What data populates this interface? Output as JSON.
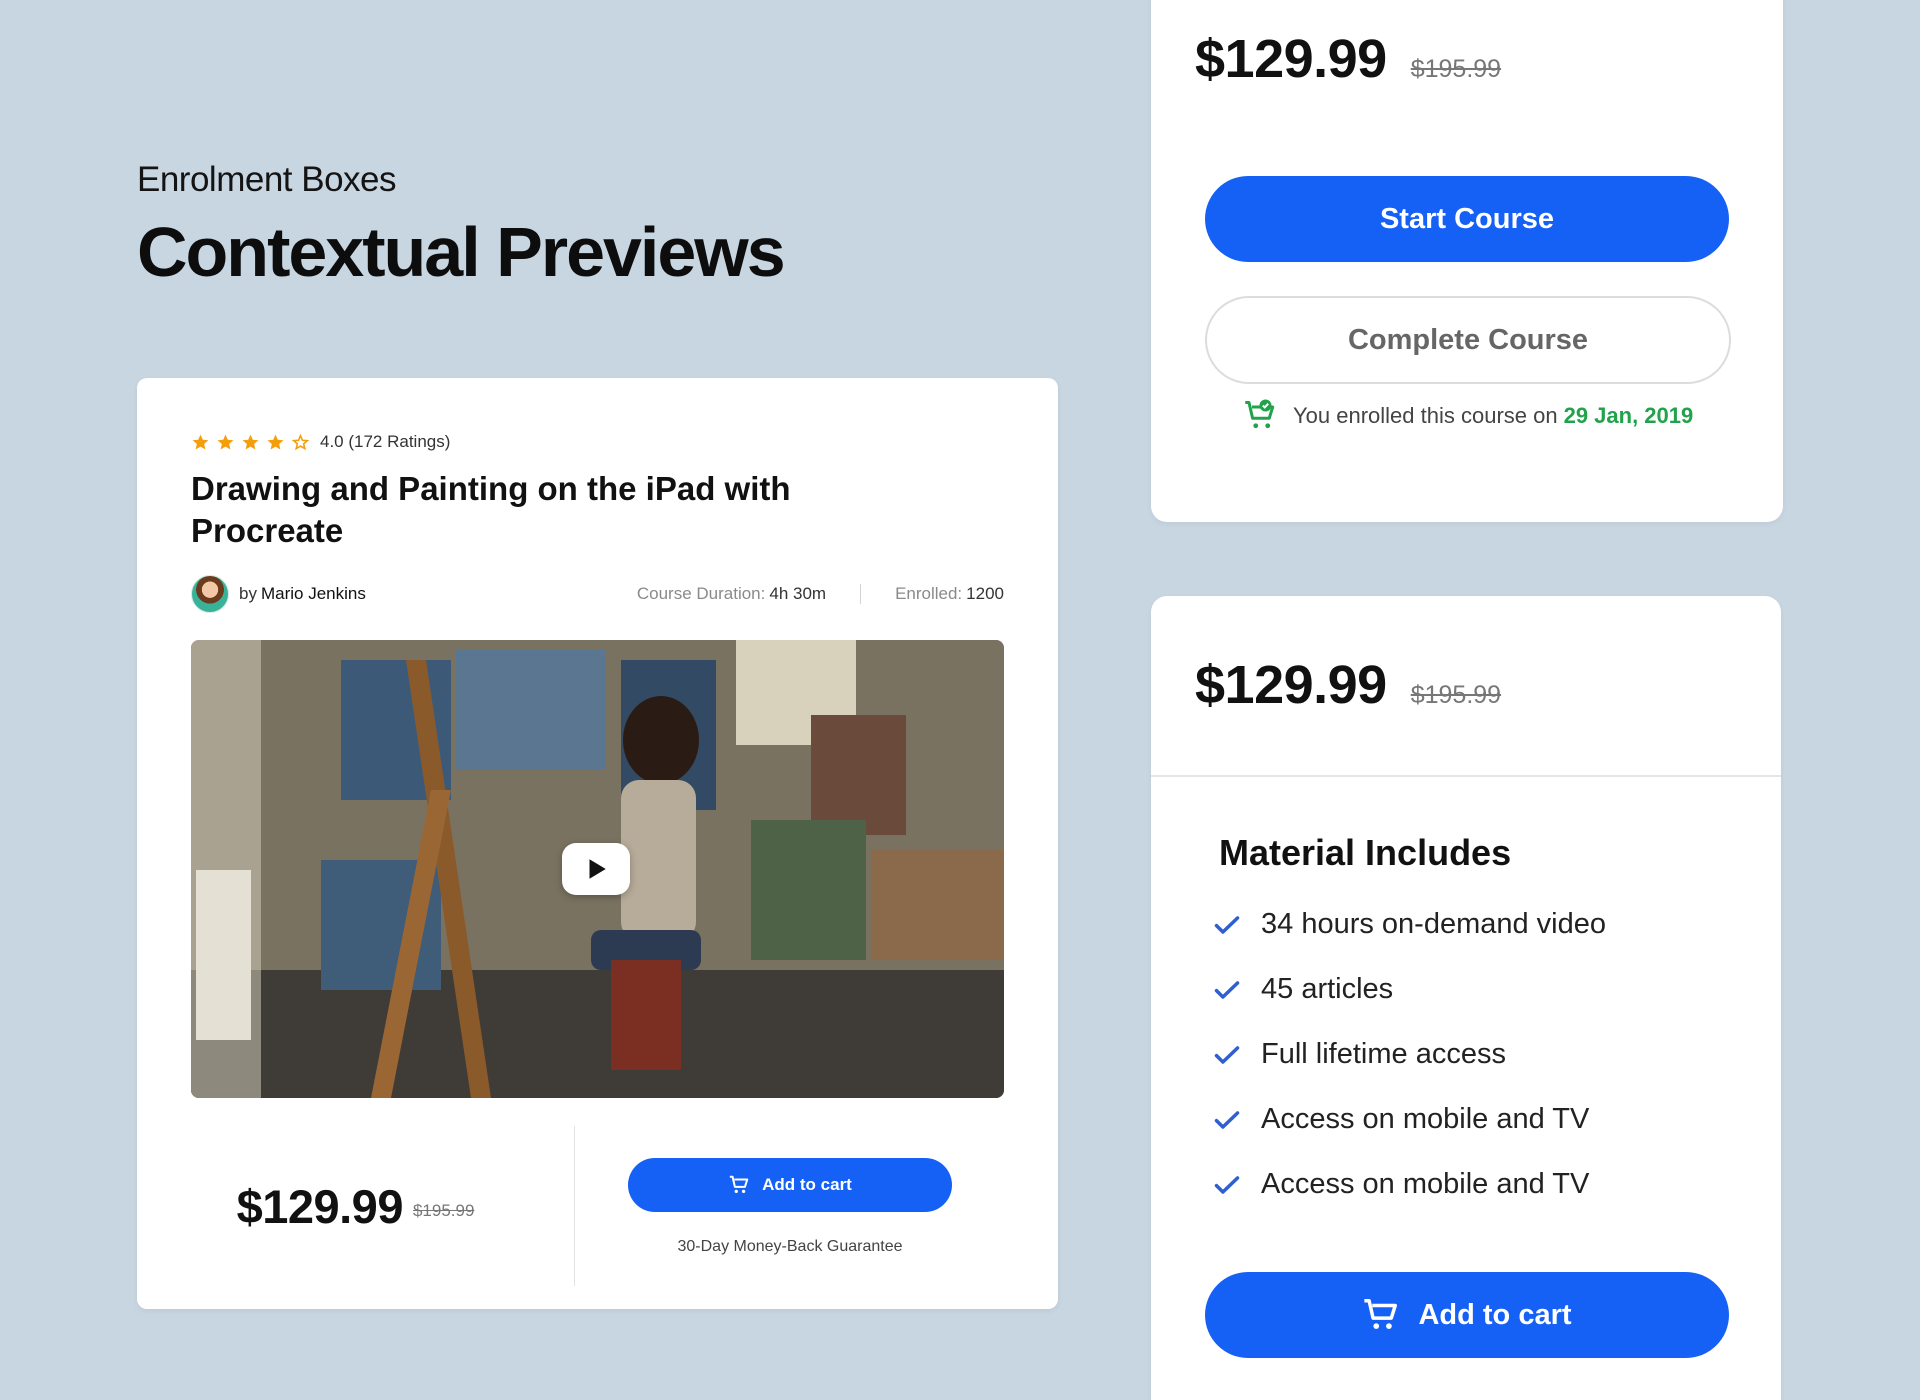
{
  "header": {
    "kicker": "Enrolment Boxes",
    "title": "Contextual Previews"
  },
  "course_card": {
    "rating": {
      "stars_filled": 4,
      "stars_total": 5,
      "text": "4.0 (172 Ratings)",
      "star_color": "#f59e0b"
    },
    "title": "Drawing and Painting on the iPad with Procreate",
    "author_prefix": "by",
    "author_name": "Mario Jenkins",
    "duration_label": "Course Duration:",
    "duration_value": "4h 30m",
    "enrolled_label": "Enrolled:",
    "enrolled_value": "1200",
    "price": "$129.99",
    "old_price": "$195.99",
    "cart_button": "Add to cart",
    "guarantee": "30-Day Money-Back Guarantee"
  },
  "enrolled_card": {
    "price": "$129.99",
    "old_price": "$195.99",
    "start_button": "Start Course",
    "complete_button": "Complete Course",
    "enrolled_text": "You enrolled this course on",
    "enrolled_date": "29 Jan, 2019"
  },
  "material_card": {
    "price": "$129.99",
    "old_price": "$195.99",
    "title": "Material Includes",
    "items": [
      "34 hours on-demand video",
      "45 articles",
      "Full lifetime access",
      "Access on mobile and TV",
      "Access on mobile and TV"
    ],
    "cart_button": "Add to cart"
  },
  "colors": {
    "background": "#c8d6e2",
    "primary": "#1560f5",
    "success": "#20a34a",
    "check": "#2f5fd0"
  }
}
